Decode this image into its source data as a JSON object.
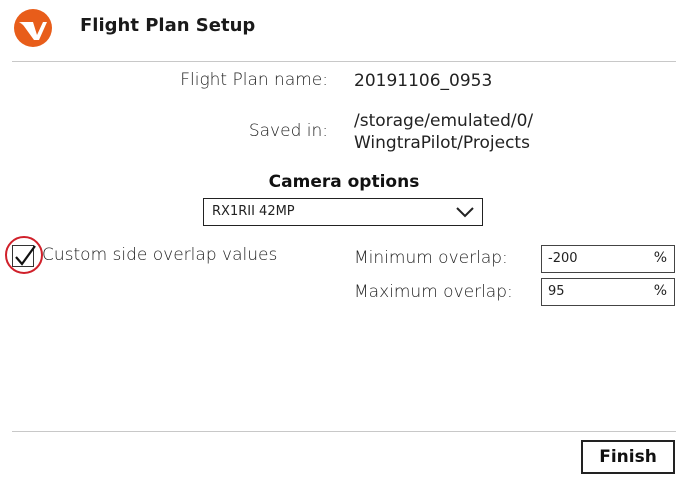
{
  "header": {
    "title": "Flight Plan Setup",
    "logo_icon": "wingtra-logo-icon",
    "brand_color": "#e85d1a"
  },
  "form": {
    "name_label": "Flight Plan name:",
    "name_value": "20191106_0953",
    "saved_label": "Saved in:",
    "saved_line1": "/storage/emulated/0/",
    "saved_line2": "WingtraPilot/Projects"
  },
  "camera": {
    "section_title": "Camera options",
    "selected": "RX1RII 42MP",
    "dropdown_icon": "chevron-down-icon"
  },
  "overlap": {
    "checkbox_label": "Custom side overlap values",
    "checked": true,
    "highlight_color": "#d0202a",
    "min_label": "Minimum overlap:",
    "min_value": "-200",
    "max_label": "Maximum overlap:",
    "max_value": "95",
    "unit": "%"
  },
  "footer": {
    "finish_label": "Finish"
  }
}
